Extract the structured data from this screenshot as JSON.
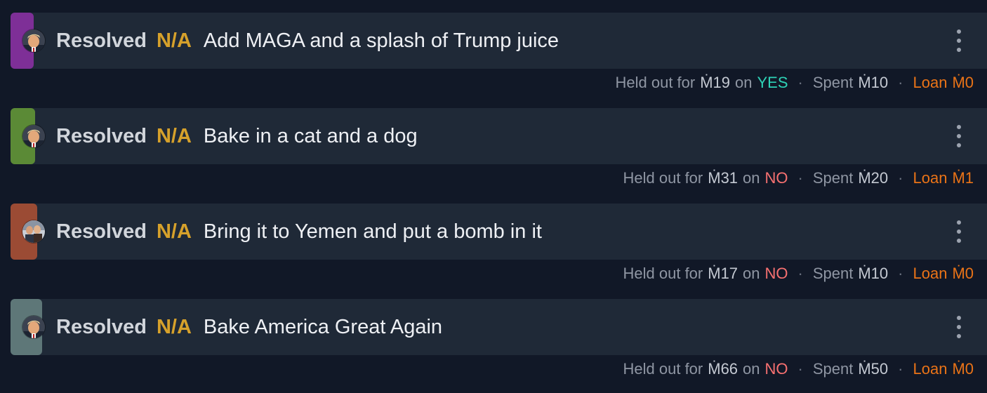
{
  "bets": [
    {
      "status": "Resolved",
      "outcome": "N/A",
      "question": "Add MAGA and a splash of Trump juice",
      "accent_color": "#7e2f97",
      "avatar": "trump-avatar",
      "held_label": "Held out for",
      "held_amount": "Ṁ19",
      "on_label": "on",
      "side": "YES",
      "spent_label": "Spent",
      "spent_amount": "Ṁ10",
      "loan_label": "Loan",
      "loan_amount": "Ṁ0"
    },
    {
      "status": "Resolved",
      "outcome": "N/A",
      "question": "Bake in a cat and a dog",
      "accent_color": "#5b8a36",
      "avatar": "trump-avatar",
      "held_label": "Held out for",
      "held_amount": "Ṁ31",
      "on_label": "on",
      "side": "NO",
      "spent_label": "Spent",
      "spent_amount": "Ṁ20",
      "loan_label": "Loan",
      "loan_amount": "Ṁ1"
    },
    {
      "status": "Resolved",
      "outcome": "N/A",
      "question": "Bring it to Yemen and put a bomb in it",
      "accent_color": "#9b4b34",
      "avatar": "group-photo-avatar",
      "held_label": "Held out for",
      "held_amount": "Ṁ17",
      "on_label": "on",
      "side": "NO",
      "spent_label": "Spent",
      "spent_amount": "Ṁ10",
      "loan_label": "Loan",
      "loan_amount": "Ṁ0"
    },
    {
      "status": "Resolved",
      "outcome": "N/A",
      "question": "Bake America Great Again",
      "accent_color": "#5e7778",
      "avatar": "trump-avatar",
      "held_label": "Held out for",
      "held_amount": "Ṁ66",
      "on_label": "on",
      "side": "NO",
      "spent_label": "Spent",
      "spent_amount": "Ṁ50",
      "loan_label": "Loan",
      "loan_amount": "Ṁ0"
    }
  ],
  "separator": "·",
  "colors": {
    "background": "#111827",
    "card": "#1f2937",
    "outcome": "#d6a12b",
    "yes": "#2ed3b7",
    "no": "#f87171",
    "loan": "#ea7317"
  }
}
